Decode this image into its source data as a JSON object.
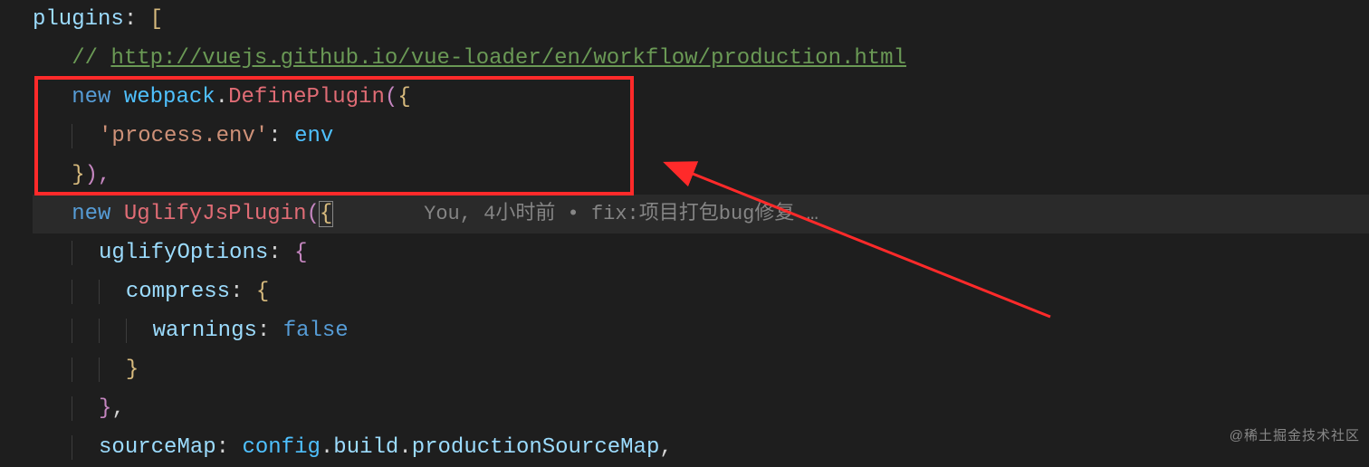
{
  "code": {
    "l1": {
      "prop": "plugins",
      "punc1": ": ",
      "brkt": "["
    },
    "l2": {
      "slashes": "// ",
      "url": "http://vuejs.github.io/vue-loader/en/workflow/production.html"
    },
    "l3": {
      "kw": "new",
      "sp": " ",
      "obj": "webpack",
      "dot": ".",
      "cls": "DefinePlugin",
      "open": "(",
      "brace": "{"
    },
    "l4": {
      "str": "'process.env'",
      "colon": ": ",
      "var": "env"
    },
    "l5": {
      "brace": "}",
      "close": "),"
    },
    "l6": {
      "kw": "new",
      "sp": " ",
      "cls": "UglifyJsPlugin",
      "open": "(",
      "brace": "{"
    },
    "l7": {
      "prop": "uglifyOptions",
      "colon": ": ",
      "brace": "{"
    },
    "l8": {
      "prop": "compress",
      "colon": ": ",
      "brace": "{"
    },
    "l9": {
      "prop": "warnings",
      "colon": ": ",
      "val": "false"
    },
    "l10": {
      "brace": "}"
    },
    "l11": {
      "brace": "}",
      "comma": ","
    },
    "l12": {
      "prop": "sourceMap",
      "colon": ": ",
      "obj": "config",
      "dot1": ".",
      "p2": "build",
      "dot2": ".",
      "p3": "productionSourceMap",
      "comma": ","
    }
  },
  "blame": {
    "author": "You",
    "sep1": ", ",
    "time": "4小时前",
    "bullet": " • ",
    "msg": "fix:项目打包bug修复 …"
  },
  "watermark": "@稀土掘金技术社区"
}
